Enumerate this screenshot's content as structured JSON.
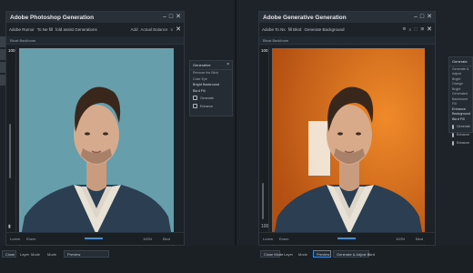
{
  "left_window": {
    "title": "Adobe Photoshop Generation",
    "menu": [
      "Adobe Rumor",
      "To Ne fill",
      "fold assist Generations"
    ],
    "toolbar_label": "Bkrat Backbone",
    "right_tools": [
      "Add",
      "Actual Balance",
      "≡",
      "✕"
    ],
    "zoom": "100",
    "panel": {
      "title": "Generative",
      "lines": [
        "Remove the Bkrd",
        "Color Eye"
      ],
      "bold": [
        "Bright Backround",
        "Bkrd Fill"
      ],
      "rows": [
        "Generate",
        "Enhance"
      ]
    },
    "bottom_labels": [
      "Lorem",
      "Enem",
      "100%",
      "Bkrd"
    ],
    "colors": {
      "backdrop": "#5e97a6"
    }
  },
  "right_window": {
    "title": "Adobe Generative Generation",
    "menu": [
      "Adobe To Ns",
      "fill Bkrd",
      "Generate Background"
    ],
    "toolbar_label": "Bkrat Backbone",
    "right_tools": [
      "⚙",
      "≡",
      "⬚",
      "⊞",
      "✕"
    ],
    "zoom": "100",
    "panel": {
      "title": "Generate",
      "lines": [
        "Generate & Adjust",
        "Bright Orange",
        "Bright Generated",
        "Backround Fill"
      ],
      "bold": [
        "Enhance Background",
        "Bkrd Fill"
      ],
      "rows": [
        "Generate",
        "Enhance",
        "Enhance"
      ]
    },
    "bottom_labels": [
      "Lorem",
      "Enem",
      "100%",
      "Bkrd"
    ],
    "colors": {
      "backdrop": "#e0741e"
    }
  },
  "taskbar": {
    "left": [
      "Close",
      "Layer",
      "Mode",
      "Mode",
      "Preview"
    ],
    "right": [
      "Close Mode",
      "Layer",
      "Mode",
      "Preview",
      "Generate & Adjust Bkrd"
    ]
  }
}
